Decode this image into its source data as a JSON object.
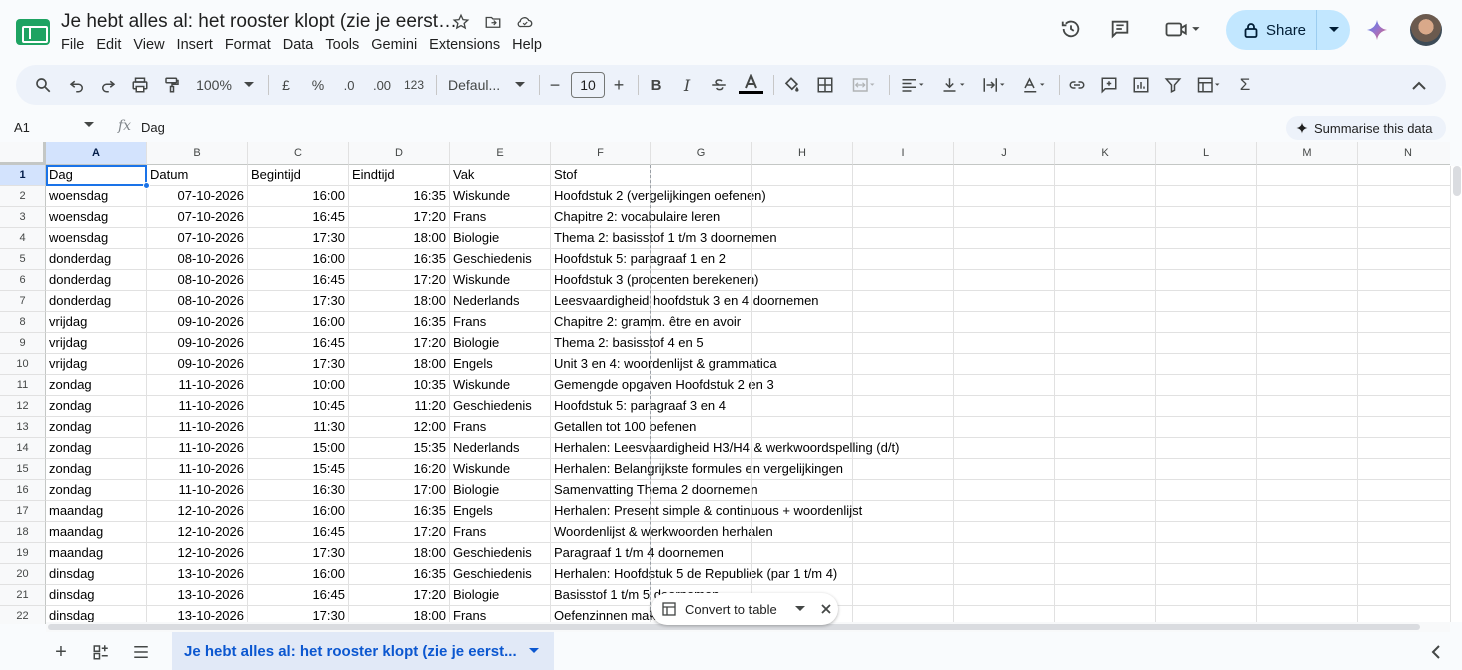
{
  "doc": {
    "title": "Je hebt alles al: het rooster klopt (zie je eerst…"
  },
  "menu": [
    "File",
    "Edit",
    "View",
    "Insert",
    "Format",
    "Data",
    "Tools",
    "Gemini",
    "Extensions",
    "Help"
  ],
  "header": {
    "share_label": "Share"
  },
  "toolbar": {
    "zoom": "100%",
    "currency": "£",
    "percent": "%",
    "dec_decrease": ".0",
    "dec_increase": ".00",
    "number_format": "123",
    "font": "Defaul...",
    "font_size": "10"
  },
  "formula_bar": {
    "cell_ref": "A1",
    "fx": "fx",
    "content": "Dag",
    "summarise_label": "Summarise this data"
  },
  "grid": {
    "columns": [
      "A",
      "B",
      "C",
      "D",
      "E",
      "F",
      "G",
      "H",
      "I",
      "J",
      "K",
      "L",
      "M",
      "N"
    ],
    "rows": [
      [
        "Dag",
        "Datum",
        "Begintijd",
        "Eindtijd",
        "Vak",
        "Stof"
      ],
      [
        "woensdag",
        "07-10-2026",
        "16:00",
        "16:35",
        "Wiskunde",
        "Hoofdstuk 2 (vergelijkingen oefenen)"
      ],
      [
        "woensdag",
        "07-10-2026",
        "16:45",
        "17:20",
        "Frans",
        "Chapitre 2: vocabulaire leren"
      ],
      [
        "woensdag",
        "07-10-2026",
        "17:30",
        "18:00",
        "Biologie",
        "Thema 2: basisstof 1 t/m 3 doornemen"
      ],
      [
        "donderdag",
        "08-10-2026",
        "16:00",
        "16:35",
        "Geschiedenis",
        "Hoofdstuk 5: paragraaf 1 en 2"
      ],
      [
        "donderdag",
        "08-10-2026",
        "16:45",
        "17:20",
        "Wiskunde",
        "Hoofdstuk 3 (procenten berekenen)"
      ],
      [
        "donderdag",
        "08-10-2026",
        "17:30",
        "18:00",
        "Nederlands",
        "Leesvaardigheid hoofdstuk 3 en 4 doornemen"
      ],
      [
        "vrijdag",
        "09-10-2026",
        "16:00",
        "16:35",
        "Frans",
        "Chapitre 2: gramm. être en avoir"
      ],
      [
        "vrijdag",
        "09-10-2026",
        "16:45",
        "17:20",
        "Biologie",
        "Thema 2: basisstof 4 en 5"
      ],
      [
        "vrijdag",
        "09-10-2026",
        "17:30",
        "18:00",
        "Engels",
        "Unit 3 en 4: woordenlijst & grammatica"
      ],
      [
        "zondag",
        "11-10-2026",
        "10:00",
        "10:35",
        "Wiskunde",
        "Gemengde opgaven Hoofdstuk 2 en 3"
      ],
      [
        "zondag",
        "11-10-2026",
        "10:45",
        "11:20",
        "Geschiedenis",
        "Hoofdstuk 5: paragraaf 3 en 4"
      ],
      [
        "zondag",
        "11-10-2026",
        "11:30",
        "12:00",
        "Frans",
        "Getallen tot 100 oefenen"
      ],
      [
        "zondag",
        "11-10-2026",
        "15:00",
        "15:35",
        "Nederlands",
        "Herhalen: Leesvaardigheid H3/H4 & werkwoordspelling (d/t)"
      ],
      [
        "zondag",
        "11-10-2026",
        "15:45",
        "16:20",
        "Wiskunde",
        "Herhalen: Belangrijkste formules en vergelijkingen"
      ],
      [
        "zondag",
        "11-10-2026",
        "16:30",
        "17:00",
        "Biologie",
        "Samenvatting Thema 2 doornemen"
      ],
      [
        "maandag",
        "12-10-2026",
        "16:00",
        "16:35",
        "Engels",
        "Herhalen: Present simple & continuous + woordenlijst"
      ],
      [
        "maandag",
        "12-10-2026",
        "16:45",
        "17:20",
        "Frans",
        "Woordenlijst & werkwoorden herhalen"
      ],
      [
        "maandag",
        "12-10-2026",
        "17:30",
        "18:00",
        "Geschiedenis",
        "Paragraaf 1 t/m 4 doornemen"
      ],
      [
        "dinsdag",
        "13-10-2026",
        "16:00",
        "16:35",
        "Geschiedenis",
        "Herhalen: Hoofdstuk 5 de Republiek (par 1 t/m 4)"
      ],
      [
        "dinsdag",
        "13-10-2026",
        "16:45",
        "17:20",
        "Biologie",
        "Basisstof 1 t/m 5 doornemen"
      ],
      [
        "dinsdag",
        "13-10-2026",
        "17:30",
        "18:00",
        "Frans",
        "Oefenzinnen maken"
      ]
    ]
  },
  "convert_pill": {
    "label": "Convert to table"
  },
  "sheet_tab": {
    "label": "Je hebt alles al: het rooster klopt (zie je eerst..."
  },
  "colors": {
    "accent": "#1a73e8",
    "share_bg": "#c2e7ff",
    "sheets_green": "#1ea362",
    "selected_header": "#d3e3fd"
  }
}
